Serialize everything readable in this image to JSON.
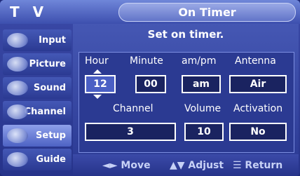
{
  "header": {
    "tv_label": "T V",
    "title": "On Timer"
  },
  "sidebar": {
    "items": [
      {
        "label": "Input",
        "icon": "input-icon"
      },
      {
        "label": "Picture",
        "icon": "picture-icon"
      },
      {
        "label": "Sound",
        "icon": "sound-icon"
      },
      {
        "label": "Channel",
        "icon": "channel-icon"
      },
      {
        "label": "Setup",
        "icon": "setup-icon"
      },
      {
        "label": "Guide",
        "icon": "guide-icon"
      }
    ]
  },
  "main": {
    "subtitle": "Set on timer.",
    "headers_row1": {
      "hour": "Hour",
      "minute": "Minute",
      "ampm": "am/pm",
      "antenna": "Antenna"
    },
    "values_row1": {
      "hour": "12",
      "minute": "00",
      "ampm": "am",
      "antenna": "Air"
    },
    "headers_row2": {
      "channel": "Channel",
      "volume": "Volume",
      "activation": "Activation"
    },
    "values_row2": {
      "channel": "3",
      "volume": "10",
      "activation": "No"
    }
  },
  "footer": {
    "move": "◄► Move",
    "adjust": "▲▼ Adjust",
    "return": "☰ Return"
  },
  "colors": {
    "panel": "#2e3d97",
    "accent": "#7c8ee0",
    "selected": "#4a5fc4"
  }
}
